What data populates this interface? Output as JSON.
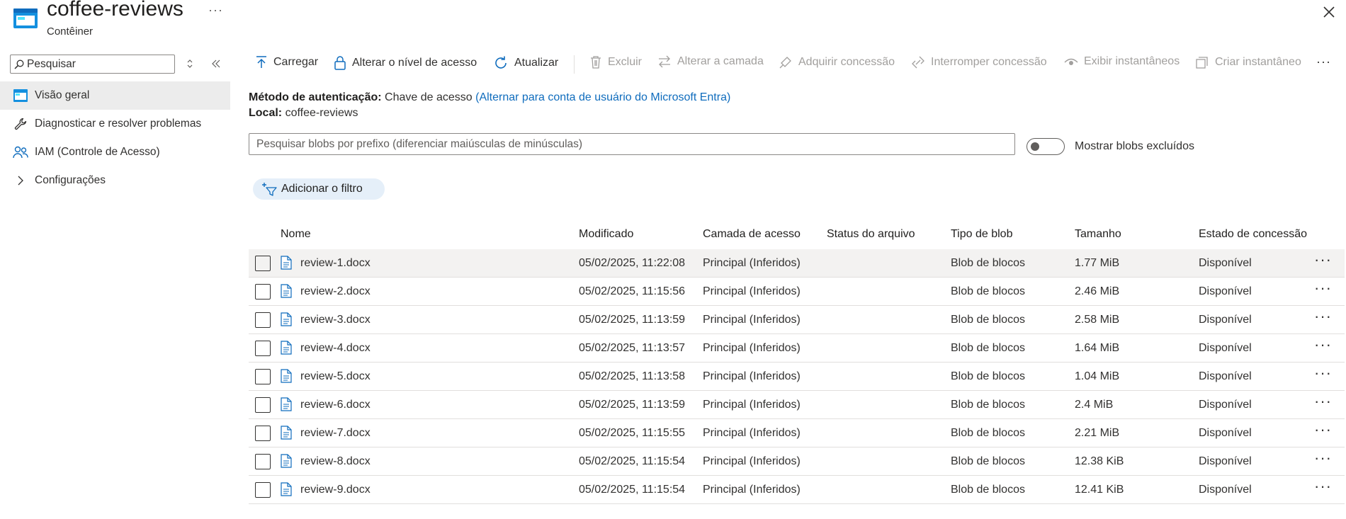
{
  "header": {
    "title": "coffee-reviews",
    "subtitle": "Contêiner",
    "more": "···"
  },
  "sidebar": {
    "search_placeholder": "Pesquisar",
    "items": [
      {
        "label": "Visão geral",
        "icon": "container-icon",
        "active": true
      },
      {
        "label": "Diagnosticar e resolver problemas",
        "icon": "wrench-icon"
      },
      {
        "label": "IAM (Controle de Acesso)",
        "icon": "people-icon"
      },
      {
        "label": "Configurações",
        "icon": "chevron-right-icon"
      }
    ]
  },
  "toolbar": {
    "upload": "Carregar",
    "access_level": "Alterar o nível de acesso",
    "refresh": "Atualizar",
    "delete": "Excluir",
    "change_tier": "Alterar a camada",
    "acquire_lease": "Adquirir concessão",
    "break_lease": "Interromper concessão",
    "view_snapshots": "Exibir instantâneos",
    "create_snapshot": "Criar instantâneo",
    "more": "···"
  },
  "auth": {
    "method_label": "Método de autenticação:",
    "method_value": "Chave de acesso",
    "switch_link": "(Alternar para conta de usuário do Microsoft Entra)",
    "location_label": "Local:",
    "location_value": "coffee-reviews"
  },
  "blob_search": {
    "placeholder": "Pesquisar blobs por prefixo (diferenciar maiúsculas de minúsculas)"
  },
  "toggle": {
    "label": "Mostrar blobs excluídos",
    "on": false
  },
  "filter": {
    "label": "Adicionar o filtro"
  },
  "table": {
    "headers": {
      "name": "Nome",
      "modified": "Modificado",
      "tier": "Camada de acesso",
      "archive_status": "Status do arquivo",
      "blob_type": "Tipo de blob",
      "size": "Tamanho",
      "lease_state": "Estado de concessão"
    },
    "rows": [
      {
        "name": "review-1.docx",
        "modified": "05/02/2025, 11:22:08",
        "tier": "Principal (Inferidos)",
        "archive_status": "",
        "blob_type": "Blob de blocos",
        "size": "1.77 MiB",
        "lease_state": "Disponível"
      },
      {
        "name": "review-2.docx",
        "modified": "05/02/2025, 11:15:56",
        "tier": "Principal (Inferidos)",
        "archive_status": "",
        "blob_type": "Blob de blocos",
        "size": "2.46 MiB",
        "lease_state": "Disponível"
      },
      {
        "name": "review-3.docx",
        "modified": "05/02/2025, 11:13:59",
        "tier": "Principal (Inferidos)",
        "archive_status": "",
        "blob_type": "Blob de blocos",
        "size": "2.58 MiB",
        "lease_state": "Disponível"
      },
      {
        "name": "review-4.docx",
        "modified": "05/02/2025, 11:13:57",
        "tier": "Principal (Inferidos)",
        "archive_status": "",
        "blob_type": "Blob de blocos",
        "size": "1.64 MiB",
        "lease_state": "Disponível"
      },
      {
        "name": "review-5.docx",
        "modified": "05/02/2025, 11:13:58",
        "tier": "Principal (Inferidos)",
        "archive_status": "",
        "blob_type": "Blob de blocos",
        "size": "1.04 MiB",
        "lease_state": "Disponível"
      },
      {
        "name": "review-6.docx",
        "modified": "05/02/2025, 11:13:59",
        "tier": "Principal (Inferidos)",
        "archive_status": "",
        "blob_type": "Blob de blocos",
        "size": "2.4 MiB",
        "lease_state": "Disponível"
      },
      {
        "name": "review-7.docx",
        "modified": "05/02/2025, 11:15:55",
        "tier": "Principal (Inferidos)",
        "archive_status": "",
        "blob_type": "Blob de blocos",
        "size": "2.21 MiB",
        "lease_state": "Disponível"
      },
      {
        "name": "review-8.docx",
        "modified": "05/02/2025, 11:15:54",
        "tier": "Principal (Inferidos)",
        "archive_status": "",
        "blob_type": "Blob de blocos",
        "size": "12.38 KiB",
        "lease_state": "Disponível"
      },
      {
        "name": "review-9.docx",
        "modified": "05/02/2025, 11:15:54",
        "tier": "Principal (Inferidos)",
        "archive_status": "",
        "blob_type": "Blob de blocos",
        "size": "12.41 KiB",
        "lease_state": "Disponível"
      }
    ],
    "row_more": "···"
  },
  "colors": {
    "accent": "#0f6cbd",
    "selected_nav": "#ececec",
    "filter_pill": "#e5eff9"
  }
}
